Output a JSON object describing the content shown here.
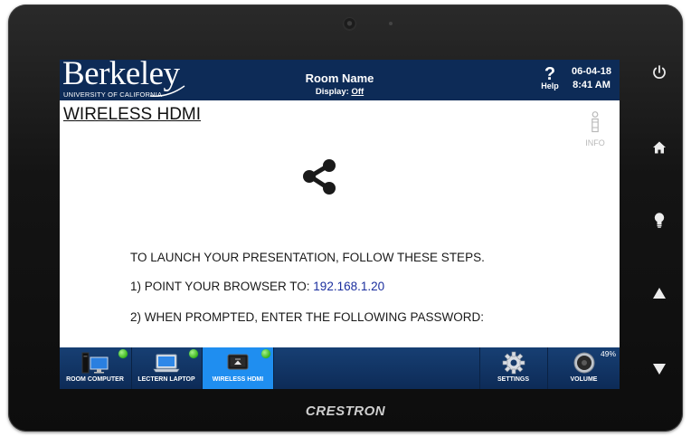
{
  "device": {
    "brand": "CRESTRON"
  },
  "header": {
    "logo_word": "Berkeley",
    "logo_sub": "UNIVERSITY OF CALIFORNIA",
    "room_name": "Room Name",
    "display_label": "Display:",
    "display_value": "Off",
    "help_symbol": "?",
    "help_label": "Help",
    "date": "06-04-18",
    "time": "8:41 AM"
  },
  "page": {
    "title": "WIRELESS HDMI",
    "info_label": "INFO",
    "instructions": {
      "line1": "TO LAUNCH YOUR PRESENTATION, FOLLOW THESE STEPS.",
      "line2_prefix": "1) POINT YOUR BROWSER TO: ",
      "line2_ip": "192.168.1.20",
      "line3": "2) WHEN PROMPTED, ENTER THE FOLLOWING PASSWORD:"
    }
  },
  "sources": [
    {
      "label": "ROOM COMPUTER",
      "icon": "desktop-computer-icon",
      "active": false,
      "status": "online"
    },
    {
      "label": "LECTERN LAPTOP",
      "icon": "laptop-icon",
      "active": false,
      "status": "online"
    },
    {
      "label": "WIRELESS HDMI",
      "icon": "wireless-display-icon",
      "active": true,
      "status": "online"
    }
  ],
  "controls": {
    "settings_label": "SETTINGS",
    "volume_label": "VOLUME",
    "volume_percent": "49%"
  },
  "colors": {
    "header_bg": "#0d2b57",
    "active_tab": "#1f8ef0",
    "status_dot": "#39b51a",
    "ip_link": "#1b2f9e"
  }
}
